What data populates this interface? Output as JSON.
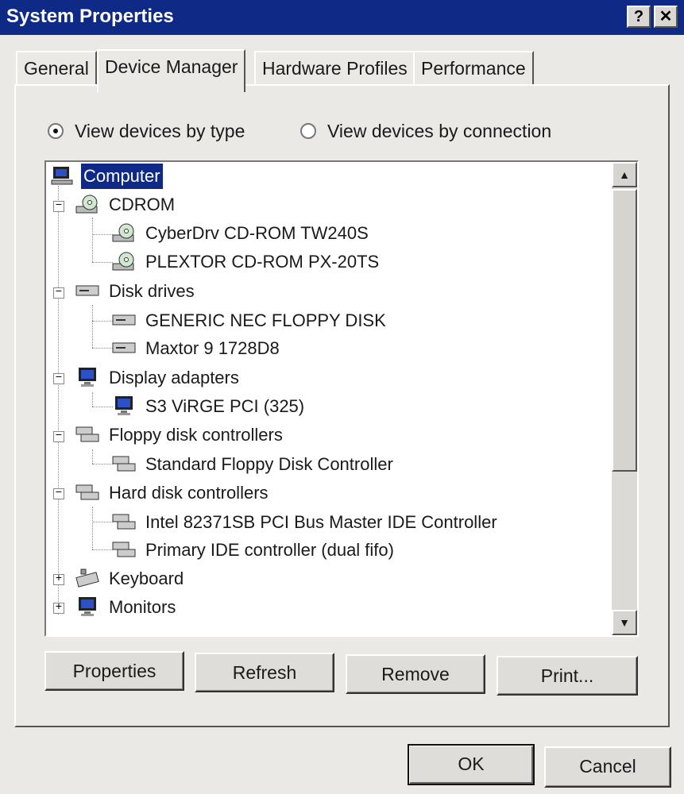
{
  "window": {
    "title": "System Properties",
    "help_glyph": "?",
    "close_glyph": "✕"
  },
  "tabs": [
    {
      "label": "General"
    },
    {
      "label": "Device Manager",
      "active": true
    },
    {
      "label": "Hardware Profiles"
    },
    {
      "label": "Performance"
    }
  ],
  "view_options": {
    "by_type": {
      "label": "View devices by type",
      "checked": true
    },
    "by_connection": {
      "label": "View devices by connection",
      "checked": false
    }
  },
  "tree": {
    "root": "Computer",
    "categories": [
      {
        "name": "CDROM",
        "icon": "cdrom-icon",
        "expanded": true,
        "children": [
          "CyberDrv  CD-ROM TW240S",
          "PLEXTOR CD-ROM PX-20TS"
        ]
      },
      {
        "name": "Disk drives",
        "icon": "disk-drive-icon",
        "expanded": true,
        "children": [
          "GENERIC NEC  FLOPPY DISK",
          "Maxtor 9 1728D8"
        ]
      },
      {
        "name": "Display adapters",
        "icon": "display-icon",
        "expanded": true,
        "children": [
          "S3 ViRGE PCI (325)"
        ]
      },
      {
        "name": "Floppy disk controllers",
        "icon": "controller-icon",
        "expanded": true,
        "children": [
          "Standard Floppy Disk Controller"
        ]
      },
      {
        "name": "Hard disk controllers",
        "icon": "controller-icon",
        "expanded": true,
        "children": [
          "Intel 82371SB PCI Bus Master IDE Controller",
          "Primary IDE controller (dual fifo)"
        ]
      },
      {
        "name": "Keyboard",
        "icon": "keyboard-icon",
        "expanded": false,
        "children": []
      },
      {
        "name": "Monitors",
        "icon": "monitor-icon",
        "expanded": false,
        "children": []
      }
    ]
  },
  "buttons": {
    "properties": "Properties",
    "refresh": "Refresh",
    "remove": "Remove",
    "print": "Print...",
    "ok": "OK",
    "cancel": "Cancel"
  },
  "colors": {
    "titlebar": "#0f2a86",
    "selection": "#0f2a86",
    "face": "#ebe9e6"
  }
}
